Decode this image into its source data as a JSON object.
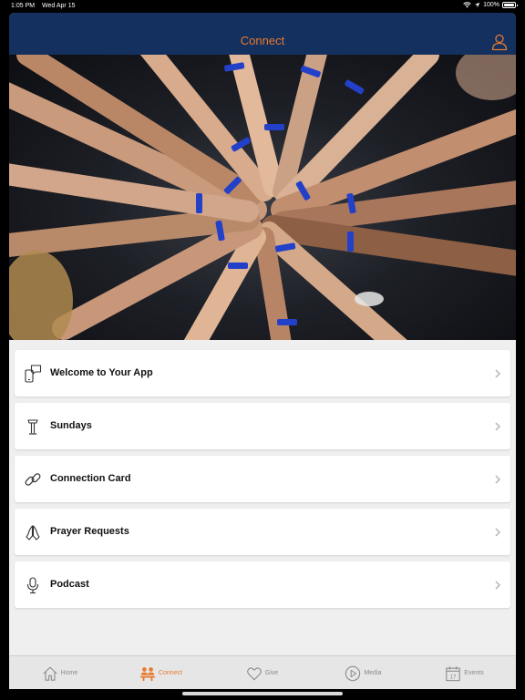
{
  "status": {
    "time": "1:05 PM",
    "date": "Wed Apr 15",
    "battery": "100%",
    "battery_level": 1.0
  },
  "colors": {
    "nav_bg": "#14305e",
    "accent": "#e87a2e",
    "tab_inactive": "#8a8a8a"
  },
  "header": {
    "title": "Connect",
    "profile_icon": "person-outline-icon"
  },
  "hero": {
    "description": "hands stacked together"
  },
  "menu": {
    "items": [
      {
        "label": "Welcome to Your App",
        "icon": "phone-chat-icon"
      },
      {
        "label": "Sundays",
        "icon": "podium-icon"
      },
      {
        "label": "Connection Card",
        "icon": "link-icon"
      },
      {
        "label": "Prayer Requests",
        "icon": "praying-hands-icon"
      },
      {
        "label": "Podcast",
        "icon": "microphone-icon"
      }
    ]
  },
  "tabs": [
    {
      "label": "Home",
      "icon": "house-icon",
      "active": false
    },
    {
      "label": "Connect",
      "icon": "people-icon",
      "active": true
    },
    {
      "label": "Give",
      "icon": "heart-icon",
      "active": false
    },
    {
      "label": "Media",
      "icon": "play-circle-icon",
      "active": false
    },
    {
      "label": "Events",
      "icon": "calendar-icon",
      "active": false
    }
  ],
  "calendar_day": "17"
}
